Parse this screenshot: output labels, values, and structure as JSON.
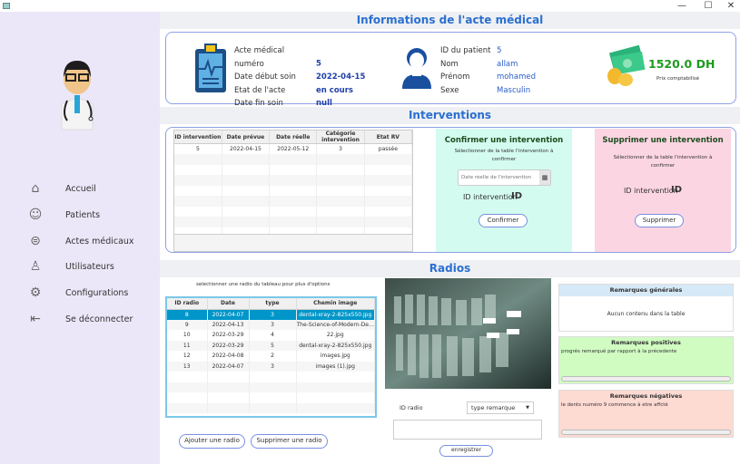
{
  "window": {
    "controls": [
      "—",
      "☐",
      "✕"
    ]
  },
  "sidebar": {
    "items": [
      {
        "label": "Accueil",
        "icon": "home-icon"
      },
      {
        "label": "Patients",
        "icon": "patient-icon"
      },
      {
        "label": "Actes médicaux",
        "icon": "list-icon"
      },
      {
        "label": "Utilisateurs",
        "icon": "user-icon"
      },
      {
        "label": "Configurations",
        "icon": "gear-icon"
      },
      {
        "label": "Se déconnecter",
        "icon": "logout-icon"
      }
    ]
  },
  "info": {
    "title": "Informations de l'acte médical",
    "acte": [
      {
        "label": "Acte médical numéro",
        "value": "5"
      },
      {
        "label": "Date début soin",
        "value": "2022-04-15"
      },
      {
        "label": "Etat de l'acte",
        "value": "en cours"
      },
      {
        "label": "Date fin soin",
        "value": "null"
      }
    ],
    "patient": [
      {
        "label": "ID du patient",
        "value": "5"
      },
      {
        "label": "Nom",
        "value": "allam"
      },
      {
        "label": "Prénom",
        "value": "mohamed"
      },
      {
        "label": "Sexe",
        "value": "Masculin"
      }
    ],
    "price": "1520.0 DH",
    "price_label": "Prix comptabilisé",
    "price_color": "#1f9a1f"
  },
  "interventions": {
    "title": "Interventions",
    "columns": [
      "ID intervention",
      "Date prévue",
      "Date réelle",
      "Catégorie intervention",
      "Etat RV"
    ],
    "rows": [
      [
        "5",
        "2022-04-15",
        "2022-05-12",
        "3",
        "passée"
      ]
    ],
    "confirm": {
      "title": "Confirmer une intervention",
      "hint": "Sélectionner de la table l'intervention à confirmer",
      "date_placeholder": "Date réelle de l'intervention",
      "id_label": "ID intervention",
      "id_value": "ID",
      "button": "Confirmer",
      "bg": "#d4fbf0"
    },
    "delete": {
      "title": "Supprimer une intervention",
      "hint": "Sélectionner de la table l'intervention à confirmer",
      "id_label": "ID intervention",
      "id_value": "ID",
      "button": "Supprimer",
      "bg": "#fcd5e3"
    }
  },
  "radios": {
    "title": "Radios",
    "hint": "selectionner une radio du tableau pour plus d'options",
    "columns": [
      "ID radio",
      "Date",
      "type",
      "Chemin image"
    ],
    "rows": [
      [
        "8",
        "2022-04-07",
        "3",
        "dental-xray-2-825x550.jpg"
      ],
      [
        "9",
        "2022-04-13",
        "3",
        "The-Science-of-Modern-Dentistry.jpg"
      ],
      [
        "10",
        "2022-03-29",
        "4",
        "22.jpg"
      ],
      [
        "11",
        "2022-03-29",
        "5",
        "dental-xray-2-825x550.jpg"
      ],
      [
        "12",
        "2022-04-08",
        "2",
        "images.jpg"
      ],
      [
        "13",
        "2022-04-07",
        "3",
        "images (1).jpg"
      ]
    ],
    "add_button": "Ajouter une radio",
    "delete_button": "Supprimer une radio",
    "id_label": "ID radio",
    "type_select": "type remarque",
    "save_button": "enregistrer",
    "remarks": {
      "general": {
        "title": "Remarques générales",
        "text": "Aucun contenu dans la table"
      },
      "positive": {
        "title": "Remarques positives",
        "text": "progrés remarqué par rapport à la précedente"
      },
      "negative": {
        "title": "Remarques négatives",
        "text": "le dents numéro 9 commence à etre affcté"
      }
    }
  }
}
